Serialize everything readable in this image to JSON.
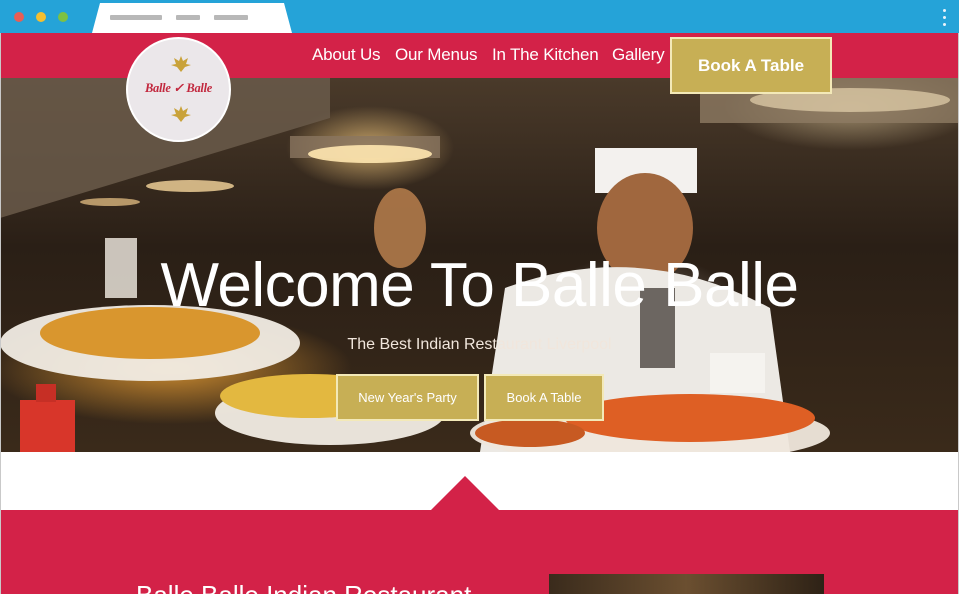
{
  "browser": {
    "window_controls": [
      "close",
      "minimize",
      "zoom"
    ],
    "menu_icon": "kebab-menu-icon"
  },
  "nav": {
    "logo_text": "Balle ✓ Balle",
    "links": [
      "About Us",
      "Our Menus",
      "In The Kitchen",
      "Gallery"
    ],
    "cta": "Book A Table"
  },
  "hero": {
    "title": "Welcome To Balle Balle",
    "subtitle": "The Best Indian Restaurant Liverpool",
    "buttons": [
      "New Year's Party",
      "Book A Table"
    ]
  },
  "intro": {
    "heading": "Balle Balle Indian Restaurant"
  },
  "colors": {
    "brand_red": "#d32248",
    "gold": "#c7af55",
    "chrome_blue": "#25a3d8"
  }
}
